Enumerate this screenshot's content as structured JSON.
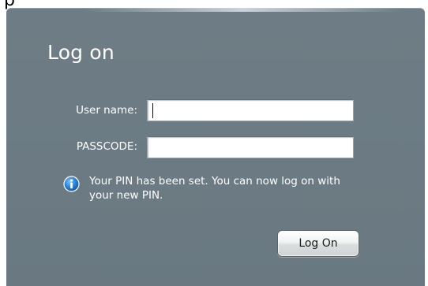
{
  "form": {
    "title": "Log on",
    "username_label": "User name:",
    "username_value": "",
    "passcode_label": "PASSCODE:",
    "passcode_value": "",
    "info_message": "Your PIN has been set. You can now log on with your new PIN.",
    "submit_label": "Log On"
  },
  "icons": {
    "info": "info-icon"
  },
  "colors": {
    "panel": "#6e7d85",
    "info_blue": "#2a7fd4"
  }
}
